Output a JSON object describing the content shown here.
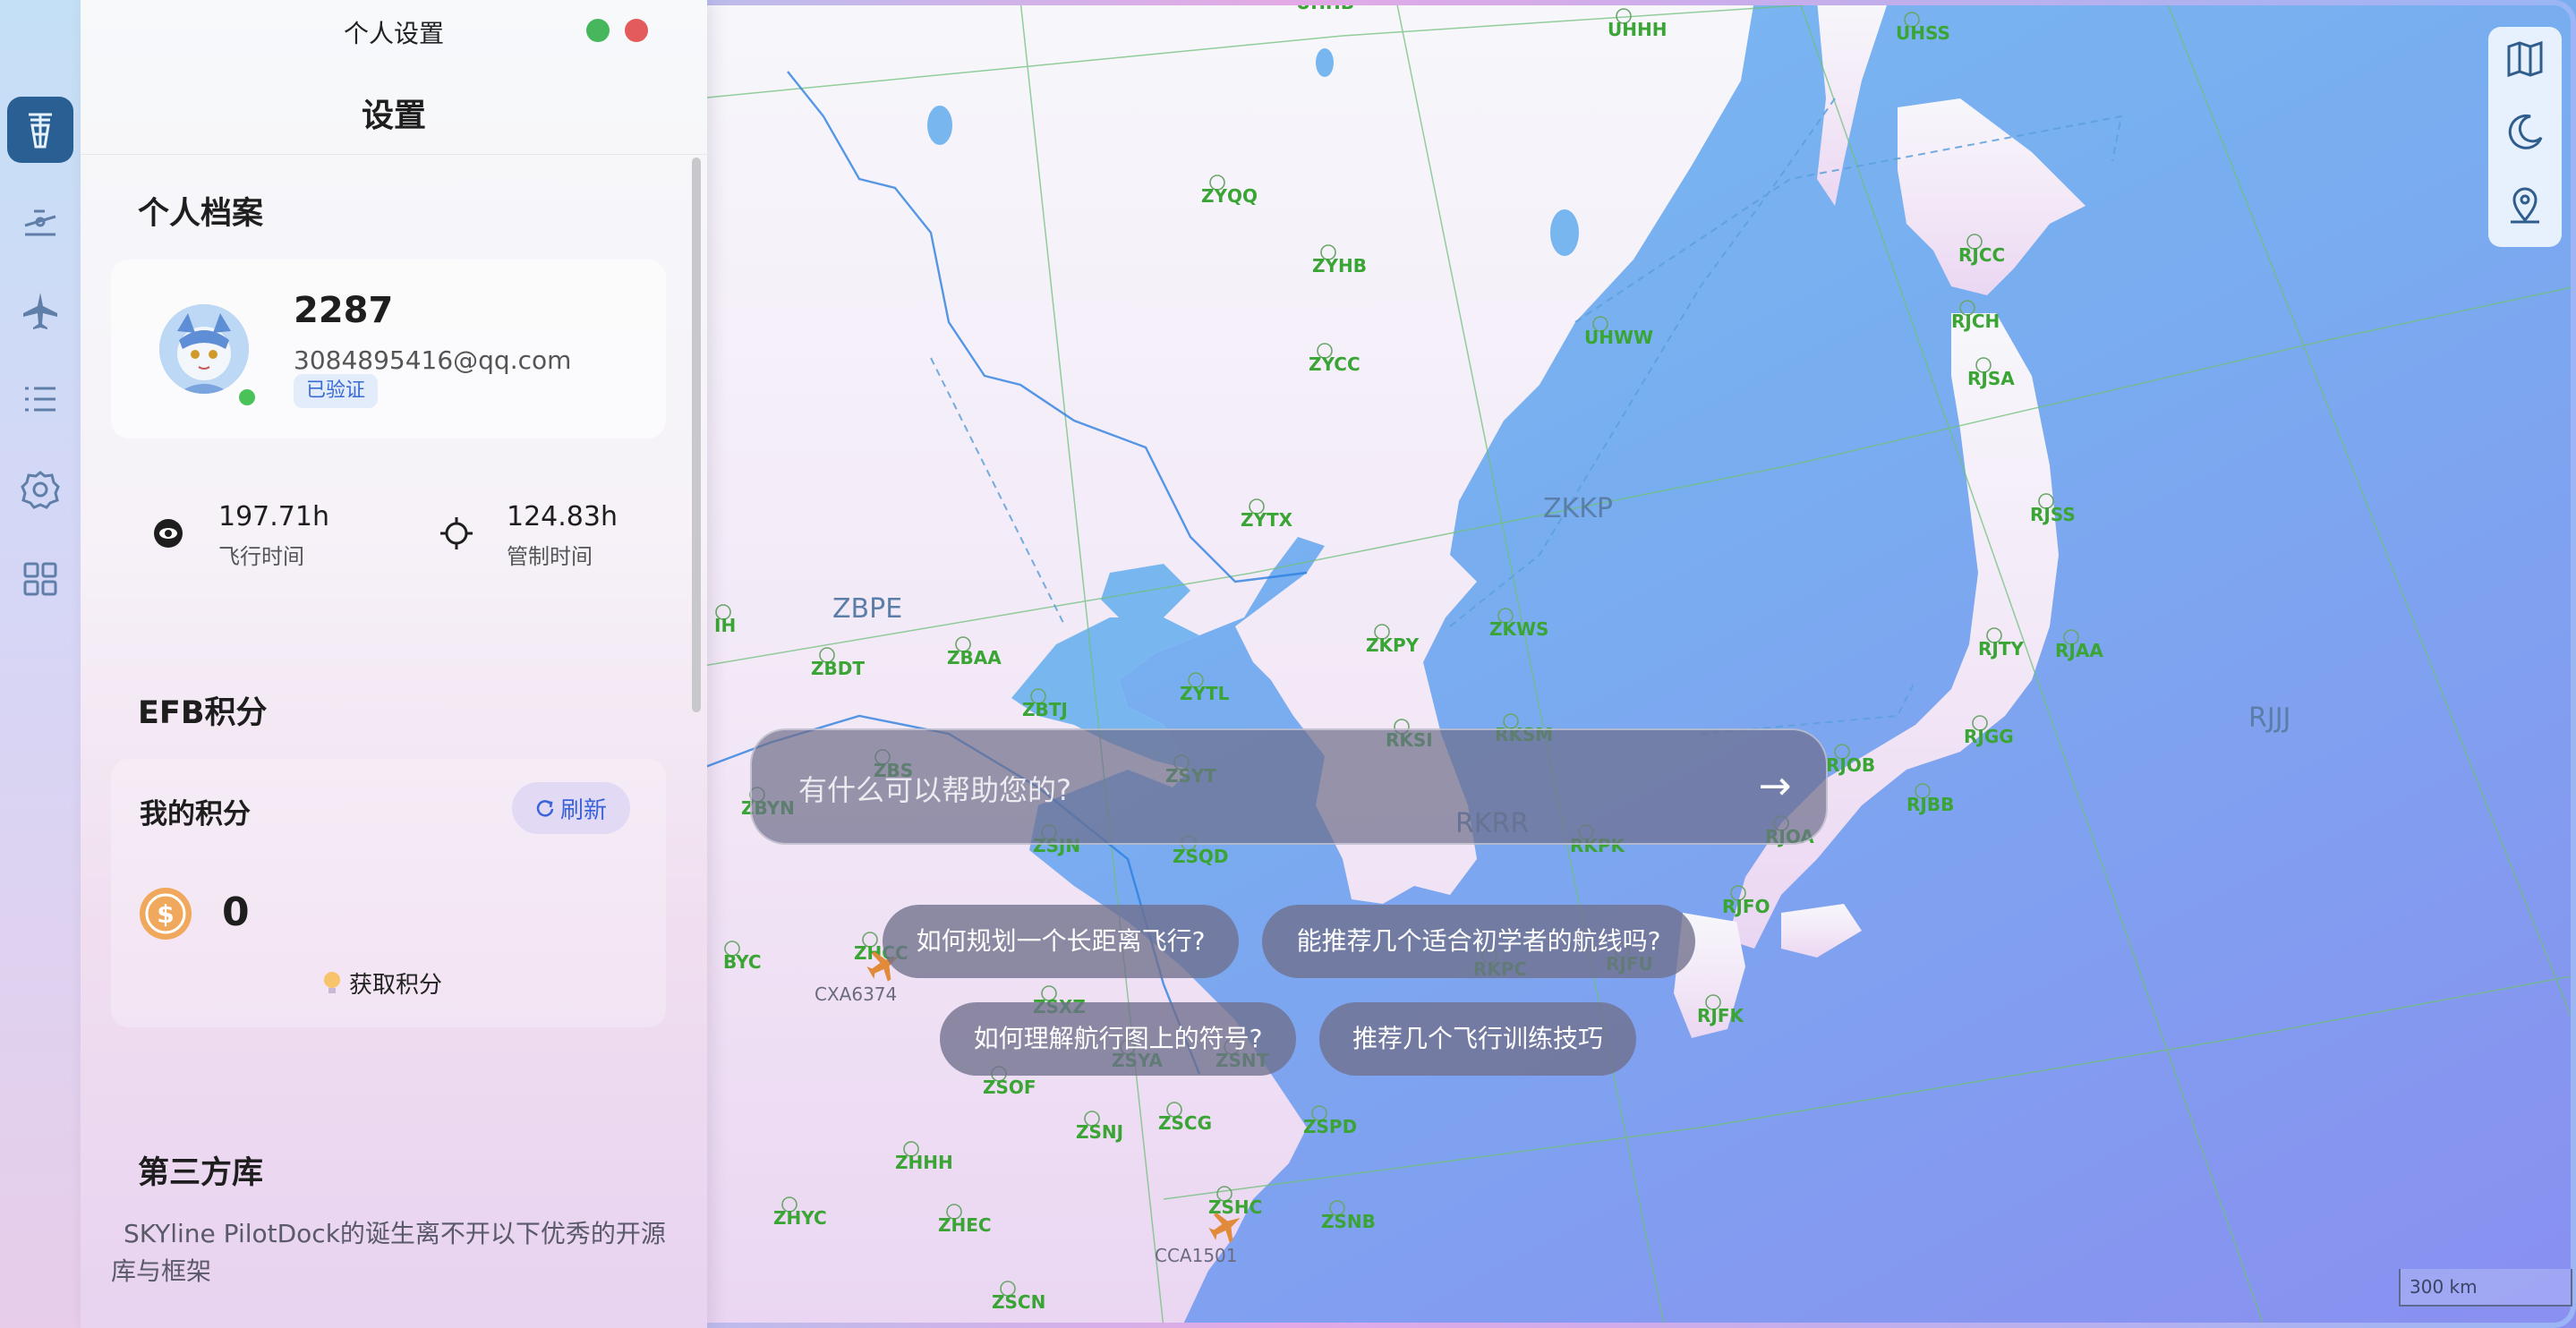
{
  "window": {
    "title": "个人设置",
    "heading": "设置"
  },
  "rail": {
    "items": [
      {
        "icon": "tower-icon",
        "active": true
      },
      {
        "icon": "airport-icon"
      },
      {
        "icon": "airplane-icon"
      },
      {
        "icon": "list-icon"
      },
      {
        "icon": "gear-icon"
      },
      {
        "icon": "grid-icon"
      }
    ]
  },
  "profile": {
    "section_title": "个人档案",
    "name": "2287",
    "email": "3084895416@qq.com",
    "badge": "已验证",
    "flight_time": "197.71h",
    "flight_time_label": "飞行时间",
    "atc_time": "124.83h",
    "atc_time_label": "管制时间"
  },
  "points": {
    "section_title": "EFB积分",
    "card_title": "我的积分",
    "refresh_label": "刷新",
    "value": "0",
    "earn_label": "获取积分"
  },
  "thirdparty": {
    "section_title": "第三方库",
    "text": "SKYline PilotDock的诞生离不开以下优秀的开源库与框架"
  },
  "assistant": {
    "placeholder": "有什么可以帮助您的?",
    "send": "→",
    "suggestions": [
      "如何规划一个长距离飞行?",
      "能推荐几个适合初学者的航线吗?",
      "如何理解航行图上的符号?",
      "推荐几个飞行训练技巧"
    ]
  },
  "map": {
    "firs": [
      "ZBPE",
      "ZKKP",
      "RKRR",
      "RJJJ"
    ],
    "airports": [
      "UHHB",
      "UHHH",
      "UHSS",
      "ZYQQ",
      "ZYHB",
      "ZYCC",
      "UHWW",
      "RJCC",
      "RJCH",
      "RJSA",
      "ZYTX",
      "RJSS",
      "IH",
      "ZBDT",
      "ZBAA",
      "ZKPY",
      "ZKWS",
      "RJTY",
      "RJAA",
      "ZYTL",
      "ZBTJ",
      "RKSI",
      "RKSM",
      "RJGG",
      "ZBYN",
      "ZSYT",
      "RJOB",
      "RJBB",
      "ZSJN",
      "ZSQD",
      "RKPK",
      "RJOA",
      "RJFO",
      "ZHCC",
      "ZSXZ",
      "RKPC",
      "RJFU",
      "BYC",
      "RJFK",
      "ZSYA",
      "ZSNT",
      "ZSOF",
      "ZSNJ",
      "ZSCG",
      "ZSPD",
      "ZHHH",
      "ZHYC",
      "ZHEC",
      "ZSHC",
      "ZSNB",
      "ZSCN",
      "ZBS"
    ],
    "flights": [
      "CXA6374",
      "CCA1501"
    ],
    "scale": "300 km"
  },
  "colors": {
    "sea": "#74b4ef",
    "land": "#f6f0fb",
    "airport_label": "#3aa535",
    "fir_label": "#5b7ea8",
    "rail_active": "#2a5f93",
    "accent": "#3a63d8"
  }
}
